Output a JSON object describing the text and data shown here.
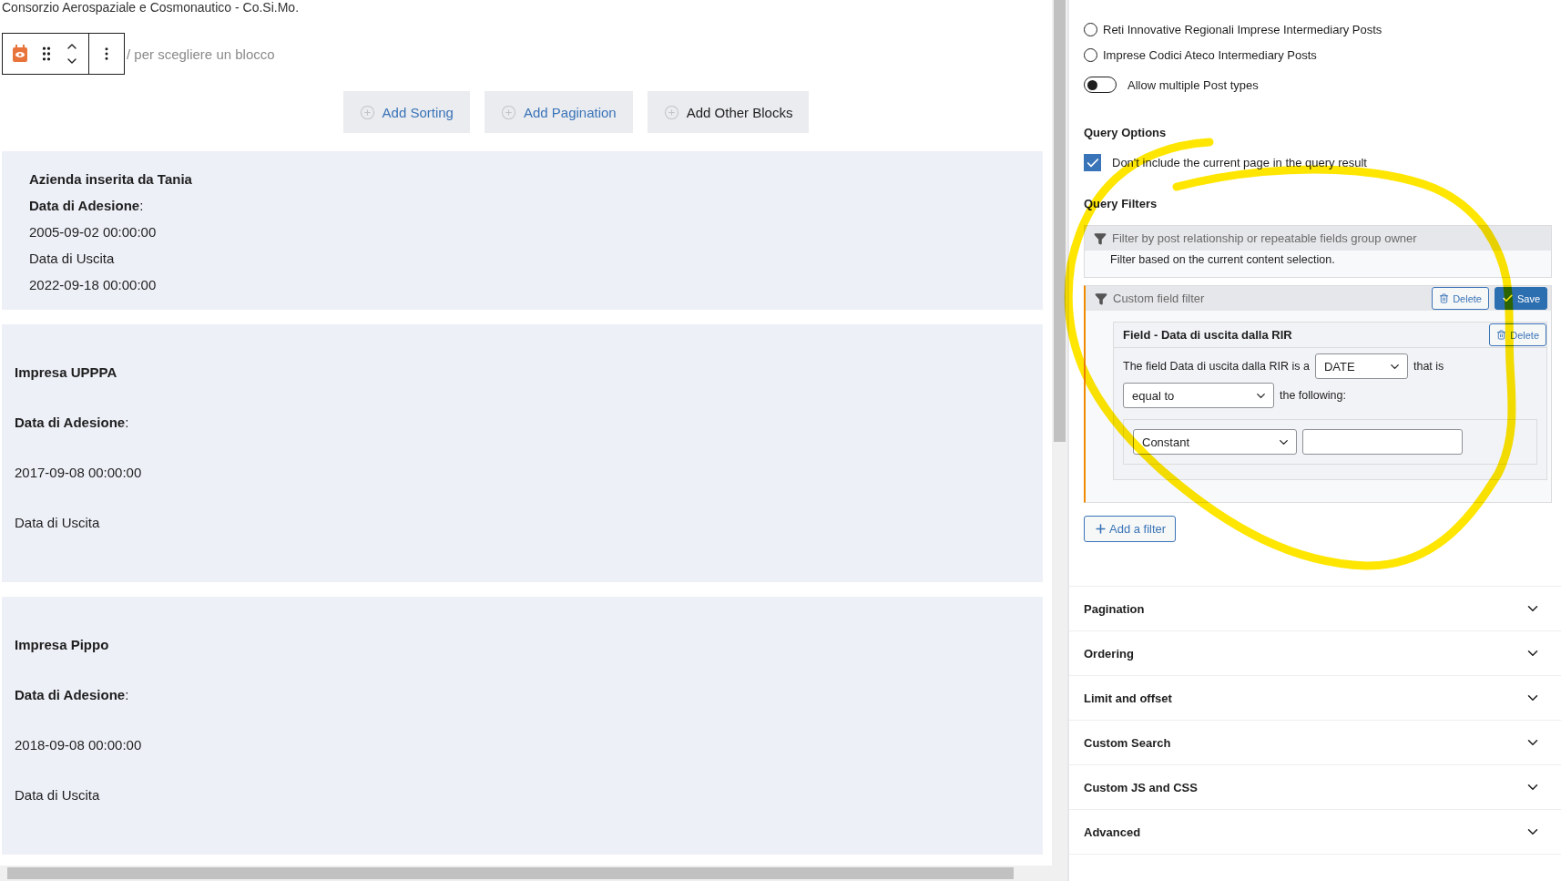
{
  "page_title": "Consorzio Aerospaziale e Cosmonautico - Co.Si.Mo.",
  "block_toolbar": {
    "hint": "/ per scegliere un blocco"
  },
  "block_buttons": [
    {
      "label": "Add Sorting",
      "kind": "link"
    },
    {
      "label": "Add Pagination",
      "kind": "link"
    },
    {
      "label": "Add Other Blocks",
      "kind": "neutral"
    }
  ],
  "posts": [
    {
      "kind": "compact",
      "title": "Azienda inserita da Tania",
      "lines": [
        "**Data di Adesione**:",
        "2005-09-02 00:00:00",
        "Data di Uscita",
        "2022-09-18 00:00:00"
      ]
    },
    {
      "kind": "spaced",
      "title": "Impresa UPPPA",
      "lines": [
        "**Data di Adesione**:",
        "2017-09-08 00:00:00",
        "Data di Uscita"
      ]
    },
    {
      "kind": "spaced",
      "title": "Impresa Pippo",
      "lines": [
        "**Data di Adesione**:",
        "2018-09-08 00:00:00",
        "Data di Uscita"
      ]
    }
  ],
  "sidebar": {
    "post_types": [
      {
        "label": "Reti Innovative Regionali Imprese Intermediary Posts",
        "selected": false
      },
      {
        "label": "Imprese Codici Ateco Intermediary Posts",
        "selected": false
      }
    ],
    "multiple_toggle": {
      "label": "Allow multiple Post types",
      "on": false
    },
    "query_options": {
      "heading": "Query Options",
      "option": {
        "label": "Don't include the current page in the query result",
        "checked": true
      }
    },
    "query_filters": {
      "heading": "Query Filters",
      "filters": [
        {
          "kind": "relationship",
          "title": "Filter by post relationship or repeatable fields group owner",
          "description": "Filter based on the current content selection."
        },
        {
          "kind": "custom_field",
          "title": "Custom field filter",
          "delete_label": "Delete",
          "save_label": "Save",
          "field": {
            "title": "Field - Data di uscita dalla RIR",
            "delete_label": "Delete",
            "sentence_start": "The field Data di uscita dalla RIR is a",
            "type_select": "DATE",
            "after_type": "that is",
            "operator_select": "equal to",
            "after_operator": "the following:",
            "source_select": "Constant"
          }
        }
      ],
      "add_filter": "Add a filter"
    },
    "sections": [
      {
        "title": "Pagination",
        "expanded": false
      },
      {
        "title": "Ordering",
        "expanded": false
      },
      {
        "title": "Limit and offset",
        "expanded": false
      },
      {
        "title": "Custom Search",
        "expanded": false
      },
      {
        "title": "Custom JS and CSS",
        "expanded": false
      },
      {
        "title": "Advanced",
        "expanded": false
      }
    ]
  }
}
